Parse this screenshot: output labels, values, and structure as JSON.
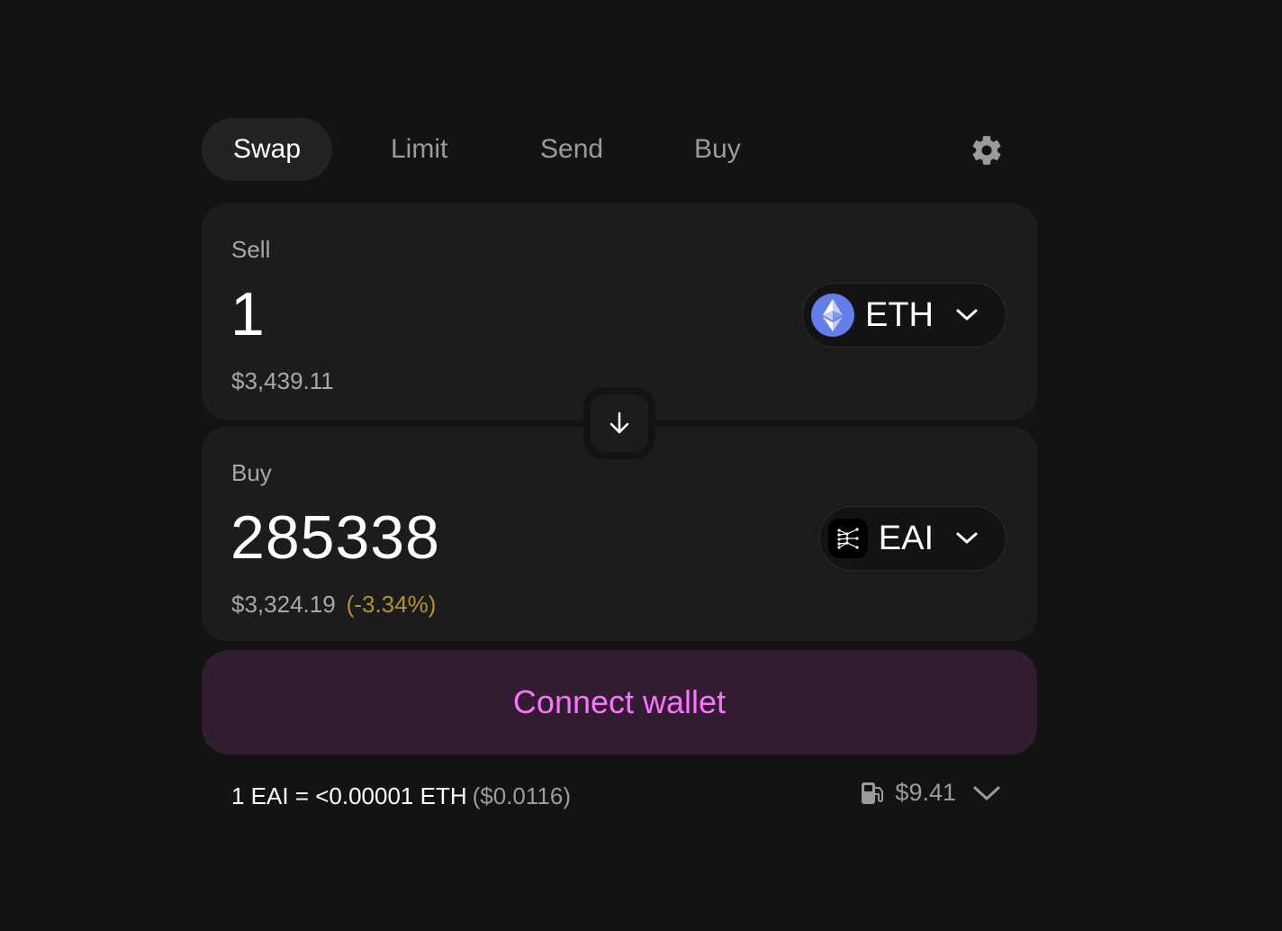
{
  "tabs": {
    "swap": "Swap",
    "limit": "Limit",
    "send": "Send",
    "buy": "Buy"
  },
  "settings_icon": "gear-icon",
  "sell": {
    "label": "Sell",
    "amount": "1",
    "usd_value": "$3,439.11",
    "token": {
      "symbol": "ETH",
      "icon": "ethereum-icon",
      "icon_color": "#627eea"
    }
  },
  "switch_icon": "arrow-down-icon",
  "buy": {
    "label": "Buy",
    "amount": "285338",
    "usd_value": "$3,324.19",
    "price_impact": "(-3.34%)",
    "price_impact_color": "#b49032",
    "token": {
      "symbol": "EAI",
      "icon": "eai-token-icon"
    }
  },
  "connect_button": {
    "label": "Connect wallet",
    "text_color": "#fc72ff",
    "bg_color": "#311c31"
  },
  "footer": {
    "rate": "1 EAI = <0.00001 ETH",
    "rate_usd": "($0.0116)",
    "gas_icon": "gas-pump-icon",
    "gas_cost": "$9.41"
  },
  "colors": {
    "background": "#131313",
    "panel": "#1c1c1c",
    "muted_text": "#9b9b9b"
  }
}
